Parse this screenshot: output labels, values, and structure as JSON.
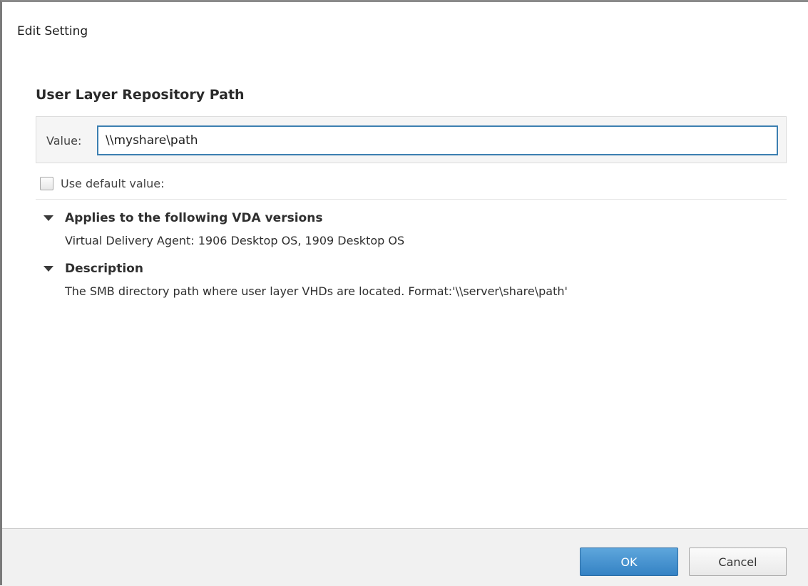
{
  "dialog": {
    "title": "Edit Setting",
    "setting_name": "User Layer Repository Path"
  },
  "value_field": {
    "label": "Value:",
    "value": "\\\\myshare\\path"
  },
  "default_option": {
    "label": "Use default value:",
    "checked": false
  },
  "sections": [
    {
      "heading": "Applies to the following VDA versions",
      "text": "Virtual Delivery Agent: 1906 Desktop OS, 1909 Desktop OS",
      "expanded": true
    },
    {
      "heading": "Description",
      "text": "The SMB directory path where user layer VHDs are located. Format:'\\\\server\\share\\path'",
      "expanded": true
    }
  ],
  "footer": {
    "ok_label": "OK",
    "cancel_label": "Cancel"
  },
  "icons": {
    "expanded_section": "triangle-down-icon",
    "checkbox": "checkbox-unchecked-icon"
  },
  "colors": {
    "accent": "#3c7fb1",
    "ok_button": "#3482c4",
    "footer_bg": "#f1f1f1"
  }
}
